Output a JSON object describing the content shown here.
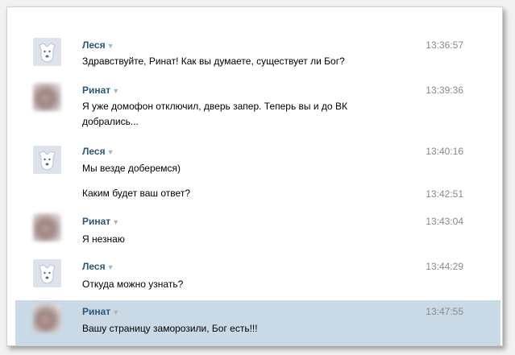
{
  "messages": [
    {
      "author": "Леся",
      "time": "13:36:57",
      "lines": [
        "Здравствуйте, Ринат! Как вы думаете, существует ли Бог?"
      ],
      "avatar": "dog-icon"
    },
    {
      "author": "Ринат",
      "time": "13:39:36",
      "lines": [
        "Я уже домофон отключил, дверь запер. Теперь вы и до ВК",
        "добрались..."
      ],
      "avatar": "user-photo"
    },
    {
      "author": "Леся",
      "time": "13:40:16",
      "lines": [
        "Мы везде доберемся)"
      ],
      "avatar": "dog-icon"
    },
    {
      "author": "",
      "time": "13:42:51",
      "lines": [
        "Каким будет ваш ответ?"
      ],
      "avatar": ""
    },
    {
      "author": "Ринат",
      "time": "13:43:04",
      "lines": [
        "Я незнаю"
      ],
      "avatar": "user-photo"
    },
    {
      "author": "Леся",
      "time": "13:44:29",
      "lines": [
        "Откуда можно узнать?"
      ],
      "avatar": "dog-icon"
    },
    {
      "author": "Ринат",
      "time": "13:47:55",
      "lines": [
        "Вашу страницу заморозили, Бог есть!!!"
      ],
      "avatar": "user-photo"
    }
  ],
  "arrow_glyph": "▼",
  "colors": {
    "author": "#2b587a",
    "selected_row": "#c9d9e6",
    "time": "#8a8a8a"
  }
}
